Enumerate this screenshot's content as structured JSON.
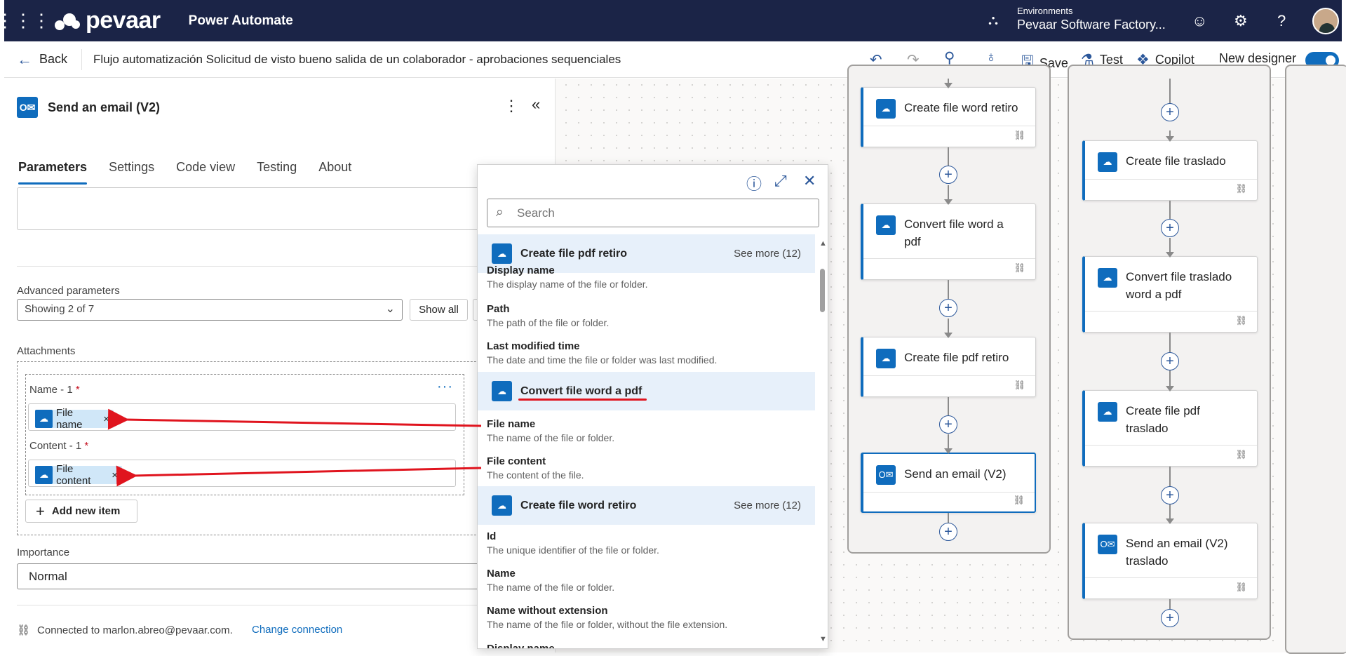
{
  "header": {
    "brand": "pevaar",
    "app_name": "Power Automate",
    "env_label": "Environments",
    "env_name": "Pevaar Software Factory..."
  },
  "cmdbar": {
    "back": "Back",
    "flow_name": "Flujo automatización Solicitud de visto bueno salida de un colaborador - aprobaciones sequenciales",
    "save": "Save",
    "test": "Test",
    "copilot": "Copilot",
    "new_designer": "New designer"
  },
  "panel": {
    "title": "Send an email (V2)",
    "tabs": [
      "Parameters",
      "Settings",
      "Code view",
      "Testing",
      "About"
    ],
    "advanced_label": "Advanced parameters",
    "advanced_value": "Showing 2 of 7",
    "show_all": "Show all",
    "attachments_label": "Attachments",
    "name_label": "Name - 1",
    "content_label": "Content - 1",
    "required_mark": "*",
    "token_name": "File name",
    "token_content": "File content",
    "token_remove": "×",
    "add_new_item": "Add new item",
    "importance_label": "Importance",
    "importance_value": "Normal",
    "connected": "Connected to marlon.abreo@pevaar.com.",
    "change_connection": "Change connection"
  },
  "popup": {
    "search_placeholder": "Search",
    "groups": [
      {
        "title": "Create file pdf retiro",
        "more": "See more (12)"
      },
      {
        "title": "Convert file word a pdf",
        "more": ""
      },
      {
        "title": "Create file word retiro",
        "more": "See more (12)"
      }
    ],
    "items_a": [
      {
        "title": "Display name",
        "desc": "The display name of the file or folder."
      },
      {
        "title": "Path",
        "desc": "The path of the file or folder."
      },
      {
        "title": "Last modified time",
        "desc": "The date and time the file or folder was last modified."
      }
    ],
    "items_b": [
      {
        "title": "File name",
        "desc": "The name of the file or folder."
      },
      {
        "title": "File content",
        "desc": "The content of the file."
      }
    ],
    "items_c": [
      {
        "title": "Id",
        "desc": "The unique identifier of the file or folder."
      },
      {
        "title": "Name",
        "desc": "The name of the file or folder."
      },
      {
        "title": "Name without extension",
        "desc": "The name of the file or folder, without the file extension."
      },
      {
        "title": "Display name",
        "desc": ""
      }
    ]
  },
  "flow_left": [
    "Create file word retiro",
    "Convert file word a pdf",
    "Create file pdf retiro",
    "Send an email (V2)"
  ],
  "flow_right": [
    "Create file traslado",
    "Convert file traslado word a pdf",
    "Create file pdf traslado",
    "Send an email (V2) traslado"
  ],
  "colors": {
    "header_bg": "#1b2447",
    "accent": "#0f6cbd",
    "annotation_red": "#e0141e"
  }
}
